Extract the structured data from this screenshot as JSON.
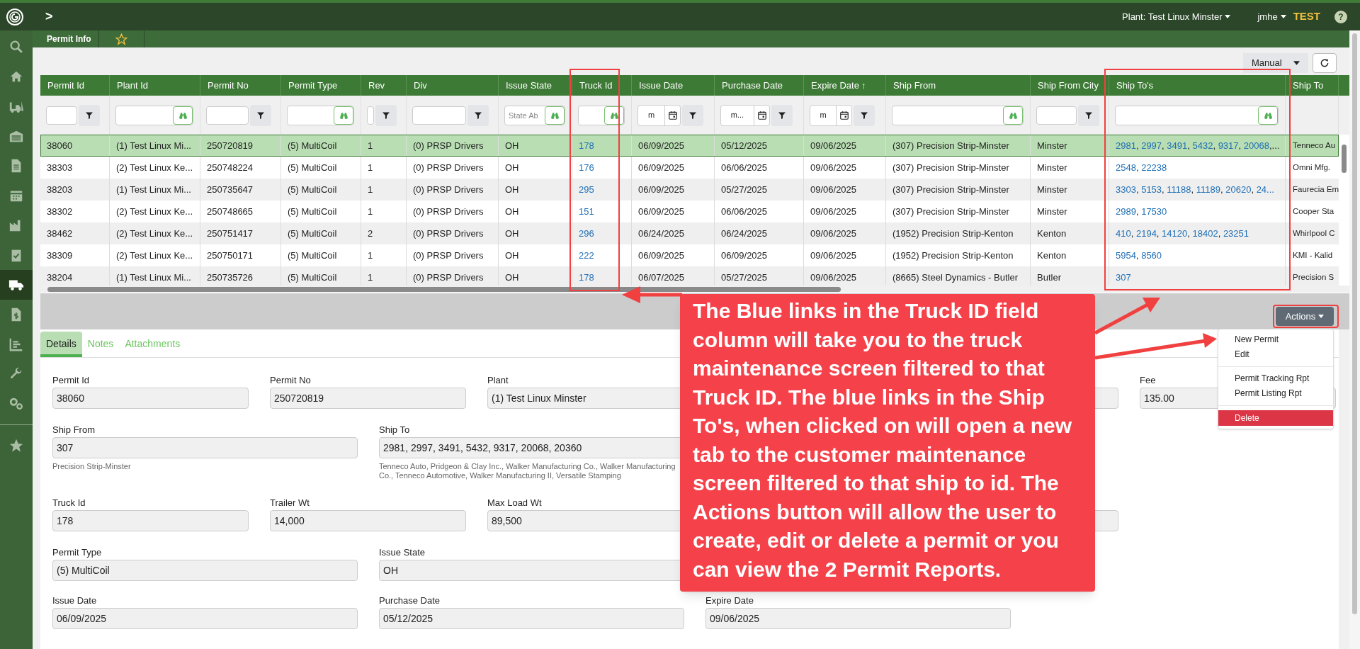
{
  "topbar": {
    "expand": ">",
    "plant": "Plant: Test Linux Minster",
    "user": "jmhe",
    "env": "TEST",
    "help": "?"
  },
  "sidebar": {
    "items": [
      {
        "selected": false
      },
      {
        "selected": false
      },
      {
        "selected": false
      },
      {
        "selected": false
      },
      {
        "selected": false
      },
      {
        "selected": false
      },
      {
        "selected": false
      },
      {
        "selected": false
      },
      {
        "selected": true
      },
      {
        "selected": false
      },
      {
        "selected": false
      },
      {
        "selected": false
      },
      {
        "selected": false
      },
      {
        "selected": false
      }
    ]
  },
  "page_tab": "Permit Info",
  "toolbar": {
    "mode": "Manual"
  },
  "table": {
    "columns": [
      {
        "label": "Permit Id",
        "kind": "text"
      },
      {
        "label": "Plant Id",
        "kind": "search"
      },
      {
        "label": "Permit No",
        "kind": "text"
      },
      {
        "label": "Permit Type",
        "kind": "search"
      },
      {
        "label": "Rev",
        "kind": "text"
      },
      {
        "label": "Div",
        "kind": "text"
      },
      {
        "label": "Issue State",
        "kind": "search",
        "placeholder": "State Ab"
      },
      {
        "label": "Truck Id",
        "kind": "search"
      },
      {
        "label": "Issue Date",
        "kind": "date",
        "placeholder": "m"
      },
      {
        "label": "Purchase Date",
        "kind": "date",
        "placeholder": "m..."
      },
      {
        "label": "Expire Date",
        "kind": "date",
        "placeholder": "m",
        "sort_mark": "↑"
      },
      {
        "label": "Ship From",
        "kind": "search"
      },
      {
        "label": "Ship From City",
        "kind": "text"
      },
      {
        "label": "Ship To's",
        "kind": "search"
      },
      {
        "label": "Ship To",
        "kind": "none"
      }
    ],
    "link_separator": ", ",
    "rows": [
      {
        "selected": true,
        "cells": [
          "38060",
          "(1) Test Linux Mi...",
          "250720819",
          "(5) MultiCoil",
          "1",
          "(0) PRSP Drivers",
          "OH"
        ],
        "truck": "178",
        "dates": [
          "06/09/2025",
          "05/12/2025",
          "09/06/2025"
        ],
        "ship_from": "(307) Precision Strip-Minster",
        "city": "Minster",
        "ship_tos": [
          "2981",
          "2997",
          "3491",
          "5432",
          "9317",
          "20068"
        ],
        "tail": ",...",
        "ship_to": "Tenneco Au"
      },
      {
        "selected": false,
        "cells": [
          "38303",
          "(2) Test Linux Ke...",
          "250748224",
          "(5) MultiCoil",
          "1",
          "(0) PRSP Drivers",
          "OH"
        ],
        "truck": "176",
        "dates": [
          "06/09/2025",
          "06/06/2025",
          "09/06/2025"
        ],
        "ship_from": "(307) Precision Strip-Minster",
        "city": "Minster",
        "ship_tos": [
          "2548",
          "22238"
        ],
        "ship_to": "Omni Mfg."
      },
      {
        "selected": false,
        "cells": [
          "38203",
          "(1) Test Linux Mi...",
          "250735647",
          "(5) MultiCoil",
          "1",
          "(0) PRSP Drivers",
          "OH"
        ],
        "truck": "295",
        "dates": [
          "06/09/2025",
          "05/27/2025",
          "09/06/2025"
        ],
        "ship_from": "(307) Precision Strip-Minster",
        "city": "Minster",
        "ship_tos": [
          "3303",
          "5153",
          "11188",
          "11189",
          "20620",
          "24..."
        ],
        "ship_to": "Faurecia Em"
      },
      {
        "selected": false,
        "cells": [
          "38302",
          "(2) Test Linux Ke...",
          "250748665",
          "(5) MultiCoil",
          "1",
          "(0) PRSP Drivers",
          "OH"
        ],
        "truck": "151",
        "dates": [
          "06/09/2025",
          "06/06/2025",
          "09/06/2025"
        ],
        "ship_from": "(307) Precision Strip-Minster",
        "city": "Minster",
        "ship_tos": [
          "2989",
          "17530"
        ],
        "ship_to": "Cooper Sta"
      },
      {
        "selected": false,
        "cells": [
          "38462",
          "(2) Test Linux Ke...",
          "250751417",
          "(5) MultiCoil",
          "2",
          "(0) PRSP Drivers",
          "OH"
        ],
        "truck": "296",
        "dates": [
          "06/24/2025",
          "06/24/2025",
          "09/06/2025"
        ],
        "ship_from": "(1952) Precision Strip-Kenton",
        "city": "Kenton",
        "ship_tos": [
          "410",
          "2194",
          "14120",
          "18402",
          "23251"
        ],
        "ship_to": "Whirlpool C"
      },
      {
        "selected": false,
        "cells": [
          "38309",
          "(2) Test Linux Ke...",
          "250750171",
          "(5) MultiCoil",
          "1",
          "(0) PRSP Drivers",
          "OH"
        ],
        "truck": "222",
        "dates": [
          "06/09/2025",
          "06/09/2025",
          "09/06/2025"
        ],
        "ship_from": "(1952) Precision Strip-Kenton",
        "city": "Kenton",
        "ship_tos": [
          "5954",
          "8560"
        ],
        "ship_to": "KMI - Kalid"
      },
      {
        "selected": false,
        "cells": [
          "38204",
          "(1) Test Linux Mi...",
          "250735726",
          "(5) MultiCoil",
          "1",
          "(0) PRSP Drivers",
          "OH"
        ],
        "truck": "178",
        "dates": [
          "06/07/2025",
          "05/27/2025",
          "09/06/2025"
        ],
        "ship_from": "(8665) Steel Dynamics - Butler",
        "city": "Butler",
        "ship_tos": [
          "307"
        ],
        "ship_to": "Precision S"
      }
    ]
  },
  "actions": {
    "label": "Actions",
    "menu": [
      {
        "kind": "item",
        "label": "New Permit",
        "selected": false
      },
      {
        "kind": "item",
        "label": "Edit",
        "selected": false
      },
      {
        "kind": "divider"
      },
      {
        "kind": "item",
        "label": "Permit Tracking Rpt",
        "selected": false
      },
      {
        "kind": "item",
        "label": "Permit Listing Rpt",
        "selected": false
      },
      {
        "kind": "divider"
      },
      {
        "kind": "item",
        "label": "Delete",
        "selected": true
      }
    ]
  },
  "detail_tabs": [
    {
      "label": "Details",
      "selected": true
    },
    {
      "label": "Notes",
      "selected": false
    },
    {
      "label": "Attachments",
      "selected": false
    }
  ],
  "form_rows": [
    [
      {
        "kind": "field",
        "label": "Permit Id",
        "value": "38060"
      },
      {
        "kind": "field",
        "label": "Permit No",
        "value": "250720819"
      },
      {
        "kind": "field",
        "label": "Plant",
        "value": "(1) Test Linux Minster"
      },
      {
        "kind": "hidden"
      },
      {
        "kind": "blank"
      },
      {
        "kind": "field",
        "label": "Fee",
        "value": "135.00"
      }
    ],
    [
      {
        "kind": "field",
        "label": "Ship From",
        "value": "307",
        "note": "Precision Strip-Minster"
      },
      {
        "kind": "field",
        "label": "Ship To",
        "value": "2981, 2997, 3491, 5432, 9317, 20068, 20360",
        "note": "Tenneco Auto, Pridgeon & Clay Inc., Walker Manufacturing Co., Walker Manufacturing Co., Tenneco Automotive, Walker Manufacturing II, Versatile Stamping"
      }
    ],
    [
      {
        "kind": "field",
        "label": "Truck Id",
        "value": "178"
      },
      {
        "kind": "field",
        "label": "Trailer Wt",
        "value": "14,000"
      },
      {
        "kind": "field",
        "label": "Max Load Wt",
        "value": "89,500"
      },
      {
        "kind": "hidden"
      },
      {
        "kind": "blank"
      }
    ],
    [
      {
        "kind": "field",
        "label": "Permit Type",
        "value": "(5) MultiCoil"
      },
      {
        "kind": "field",
        "label": "Issue State",
        "value": "OH"
      }
    ],
    [
      {
        "kind": "field",
        "label": "Issue Date",
        "value": "06/09/2025"
      },
      {
        "kind": "field",
        "label": "Purchase Date",
        "value": "05/12/2025"
      },
      {
        "kind": "field",
        "label": "Expire Date",
        "value": "09/06/2025"
      }
    ]
  ],
  "callout": {
    "text": "The Blue links in the Truck ID field column will take you to the truck maintenance screen filtered to that Truck ID. The blue links in the Ship To's, when clicked on will open a new tab to the customer maintenance screen filtered to that ship to id. The Actions button will allow the user to create, edit or delete a permit or you can view the 2 Permit Reports."
  }
}
